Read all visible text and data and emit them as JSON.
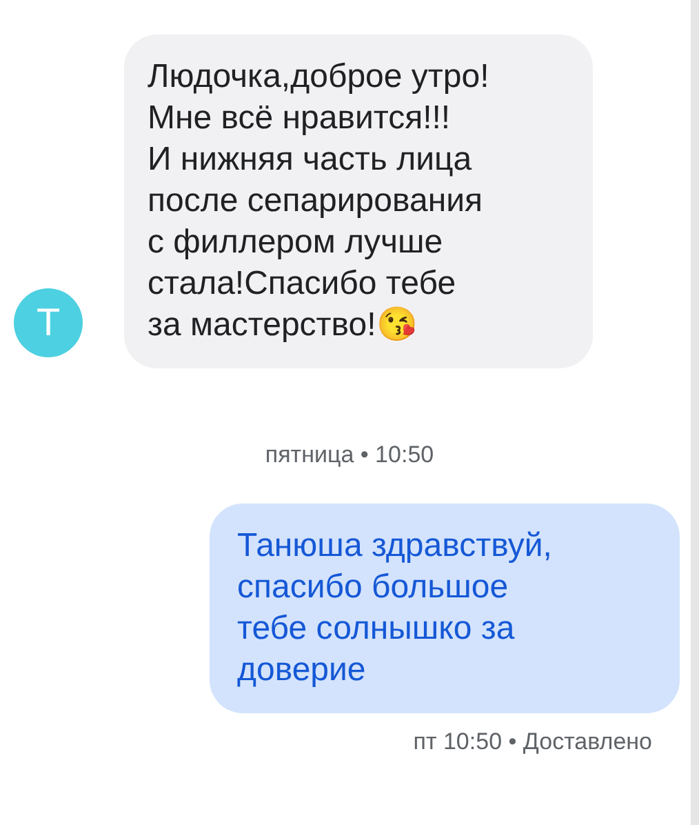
{
  "messages": [
    {
      "kind": "incoming",
      "avatar": "T",
      "text": "Людочка,доброе утро!\nМне всё нравится!!!\nИ нижняя часть лица\nпосле сепарирования\nс филлером лучше\nстала!Спасибо тебе\nза мастерство!😘"
    },
    {
      "kind": "timestamp",
      "text": "пятница • 10:50"
    },
    {
      "kind": "outgoing",
      "text": "Танюша здравствуй,\nспасибо большое\nтебе солнышко за\nдоверие"
    },
    {
      "kind": "status",
      "text": "пт 10:50 • Доставлено"
    }
  ]
}
